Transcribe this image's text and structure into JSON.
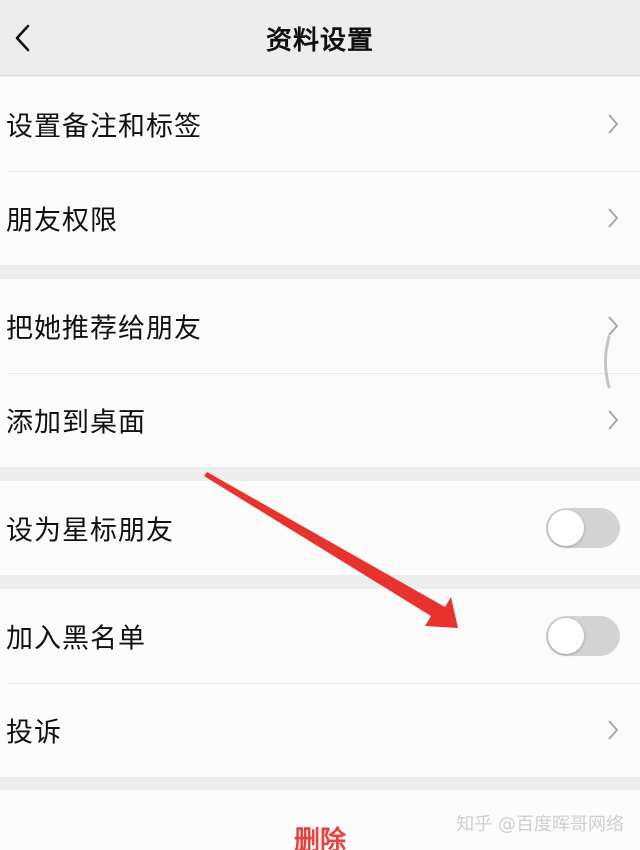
{
  "header": {
    "title": "资料设置",
    "back_icon": "chevron-left-icon"
  },
  "groups": [
    {
      "items": [
        {
          "label": "设置备注和标签",
          "control": "chevron"
        },
        {
          "label": "朋友权限",
          "control": "chevron"
        }
      ]
    },
    {
      "items": [
        {
          "label": "把她推荐给朋友",
          "control": "chevron"
        },
        {
          "label": "添加到桌面",
          "control": "chevron"
        }
      ]
    },
    {
      "items": [
        {
          "label": "设为星标朋友",
          "control": "toggle",
          "on": false
        }
      ]
    },
    {
      "items": [
        {
          "label": "加入黑名单",
          "control": "toggle",
          "on": false
        },
        {
          "label": "投诉",
          "control": "chevron"
        }
      ]
    }
  ],
  "delete": {
    "label": "删除",
    "color": "#e64340"
  },
  "annotation": {
    "color": "#e8322e"
  },
  "watermark": {
    "text": "知乎 @百度晖哥网络"
  },
  "colors": {
    "background": "#ededed",
    "row_background": "#fbfbfb",
    "toggle_off": "#d3d3d3"
  }
}
